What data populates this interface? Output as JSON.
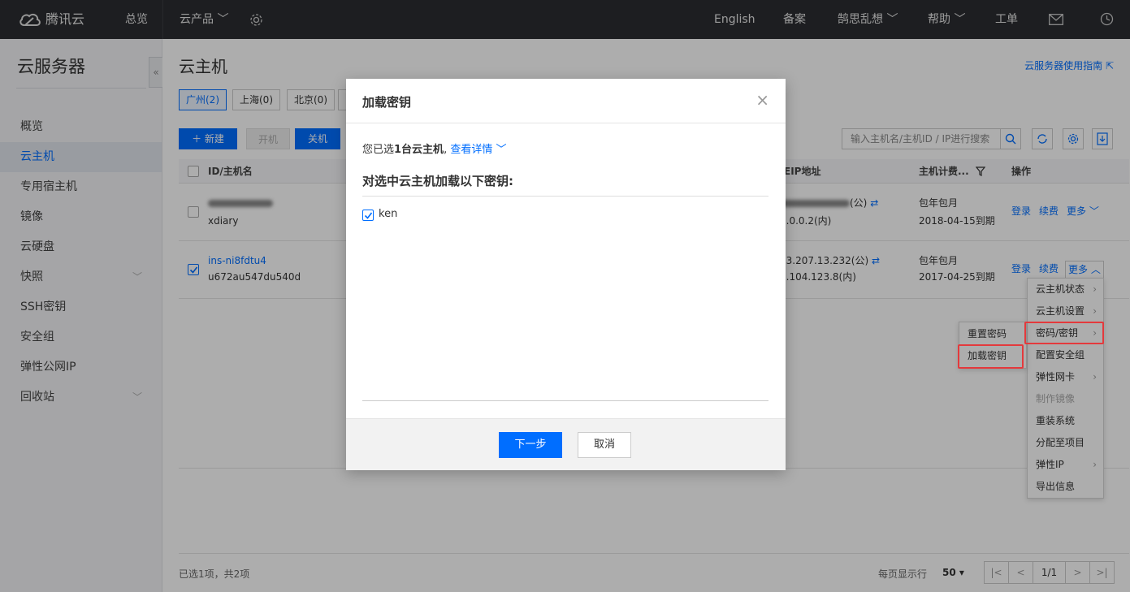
{
  "topbar": {
    "brand": "腾讯云",
    "overview": "总览",
    "products": "云产品",
    "english": "English",
    "beian": "备案",
    "user": "鹄思乱想",
    "help": "帮助",
    "ticket": "工单"
  },
  "sidebar": {
    "title": "云服务器",
    "items": [
      {
        "label": "概览"
      },
      {
        "label": "云主机"
      },
      {
        "label": "专用宿主机"
      },
      {
        "label": "镜像"
      },
      {
        "label": "云硬盘"
      },
      {
        "label": "快照"
      },
      {
        "label": "SSH密钥"
      },
      {
        "label": "安全组"
      },
      {
        "label": "弹性公网IP"
      },
      {
        "label": "回收站"
      }
    ]
  },
  "main": {
    "title": "云主机",
    "help_link": "云服务器使用指南",
    "regions": [
      "广州(2)",
      "上海(0)",
      "北京(0)"
    ],
    "new_button": "＋ 新建",
    "start_button": "开机",
    "stop_button": "关机",
    "search_placeholder": "输入主机名/主机ID / IP进行搜索",
    "columns": {
      "id": "ID/主机名",
      "eip": "EIP地址",
      "billing": "主机计费...",
      "ops": "操作"
    },
    "rows": [
      {
        "id": "",
        "name": "xdiary",
        "ip1": "(公)",
        "ip2": "0.0.0.2(内)",
        "billing": "包年包月",
        "expire": "2018-04-15到期",
        "login": "登录",
        "renew": "续费",
        "more": "更多"
      },
      {
        "id": "ins-ni8fdtu4",
        "name": "u672au547du540d",
        "ip1": "23.207.13.232(公)",
        "ip2": "0.104.123.8(内)",
        "billing": "包年包月",
        "expire": "2017-04-25到期",
        "login": "登录",
        "renew": "续费",
        "more": "更多"
      }
    ],
    "footer_selected": "已选1项，共2项",
    "per_page_label": "每页显示行",
    "per_page": "50",
    "page": "1/1"
  },
  "more_menu": [
    {
      "label": "云主机状态",
      "arrow": true,
      "disabled": false
    },
    {
      "label": "云主机设置",
      "arrow": true,
      "disabled": false
    },
    {
      "label": "密码/密钥",
      "arrow": true,
      "disabled": false
    },
    {
      "label": "配置安全组",
      "arrow": false,
      "disabled": false
    },
    {
      "label": "弹性网卡",
      "arrow": true,
      "disabled": false
    },
    {
      "label": "制作镜像",
      "arrow": false,
      "disabled": true
    },
    {
      "label": "重装系统",
      "arrow": false,
      "disabled": false
    },
    {
      "label": "分配至项目",
      "arrow": false,
      "disabled": false
    },
    {
      "label": "弹性IP",
      "arrow": true,
      "disabled": false
    },
    {
      "label": "导出信息",
      "arrow": false,
      "disabled": false
    }
  ],
  "sub_menu": [
    {
      "label": "重置密码"
    },
    {
      "label": "加载密钥"
    }
  ],
  "modal": {
    "title": "加载密钥",
    "selected_prefix": "您已选",
    "selected_count": "1台云主机",
    "comma": ",",
    "view_details": "查看详情",
    "subtitle": "对选中云主机加载以下密钥:",
    "keys": [
      {
        "name": "ken",
        "checked": true
      }
    ],
    "next_button": "下一步",
    "cancel_button": "取消"
  },
  "colors": {
    "accent": "#006eff",
    "topbar": "#2b2d31",
    "highlight": "#e4393c"
  }
}
